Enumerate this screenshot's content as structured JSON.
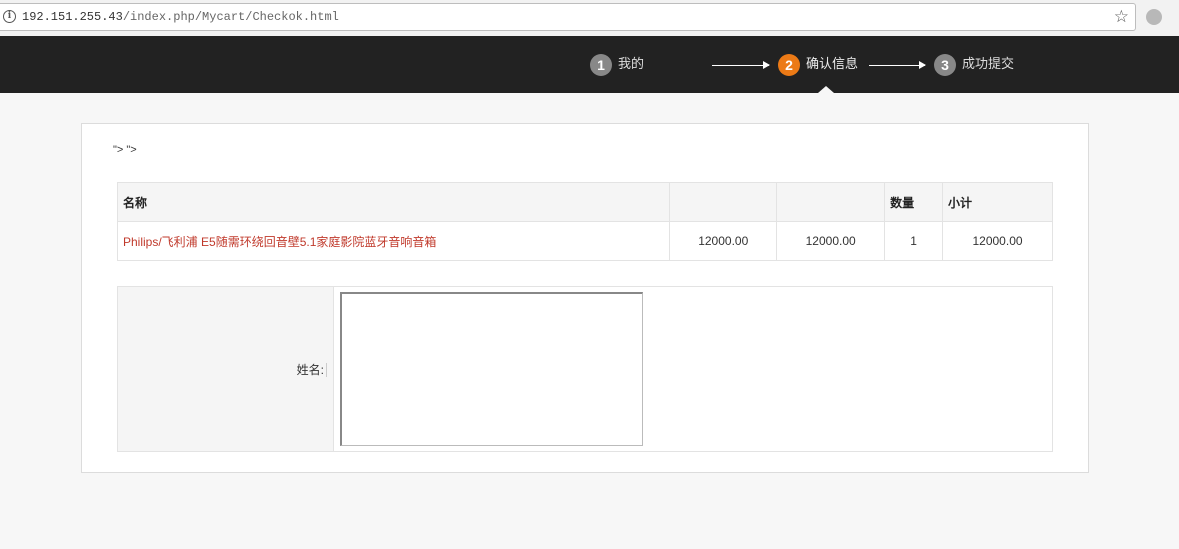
{
  "browser": {
    "url_host": "192.151.255.43",
    "url_path": "/index.php/Mycart/Checkok.html"
  },
  "steps": [
    {
      "num": "1",
      "label": "我的",
      "state": "done"
    },
    {
      "num": "2",
      "label": "确认信息",
      "state": "active"
    },
    {
      "num": "3",
      "label": "成功提交",
      "state": "pending"
    }
  ],
  "stray_text": "\"> \">",
  "cart_table": {
    "headers": [
      "名称",
      "",
      "",
      "数量",
      "小计"
    ],
    "rows": [
      {
        "name": "Philips/飞利浦 E5随需环绕回音壁5.1家庭影院蓝牙音响音箱",
        "price": "12000.00",
        "price2": "12000.00",
        "qty": "1",
        "subtotal": "12000.00"
      }
    ]
  },
  "form": {
    "name_label": "姓名:",
    "name_value": ""
  },
  "colors": {
    "header_bg": "#222222",
    "active_step": "#ec7a16",
    "product_link": "#c0392b"
  }
}
